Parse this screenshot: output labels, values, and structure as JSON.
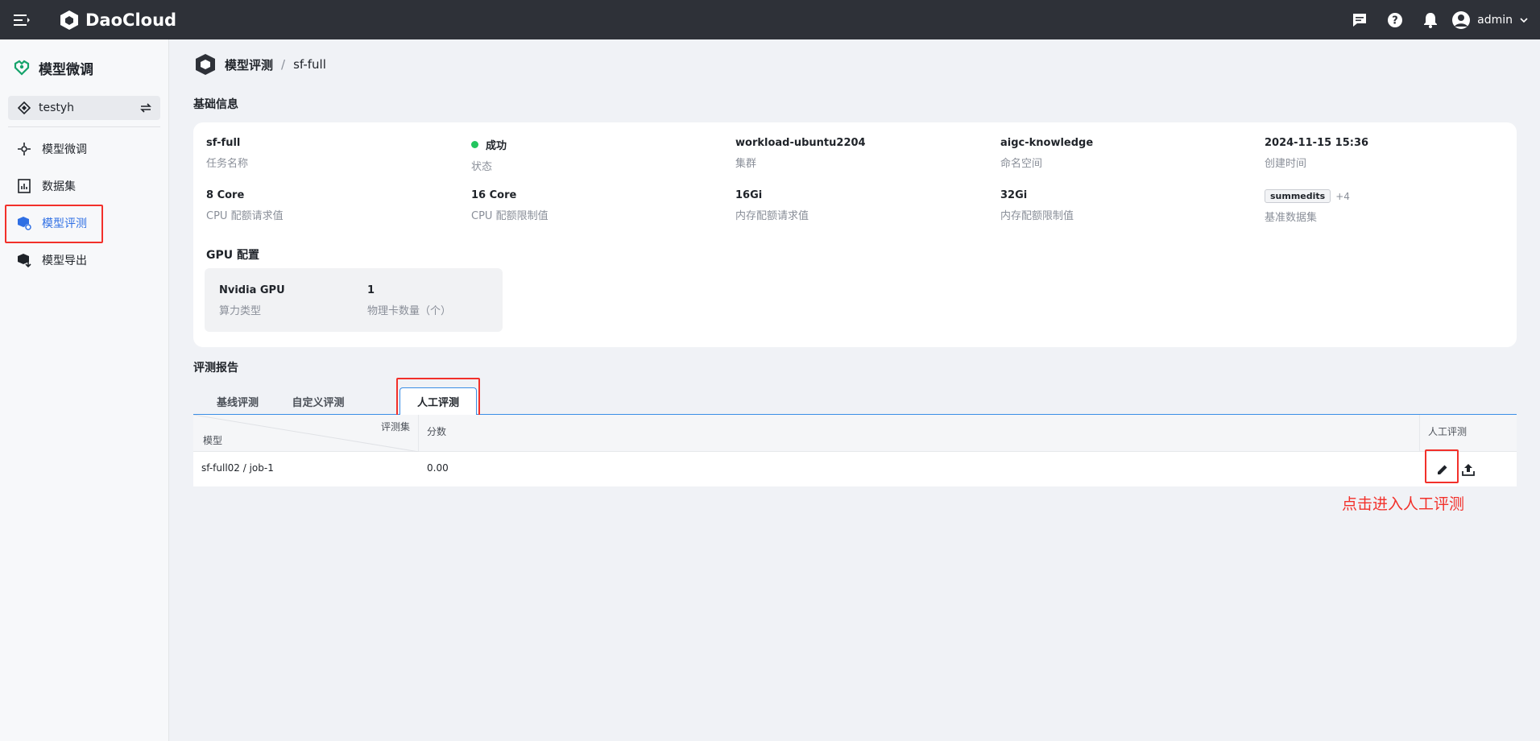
{
  "topbar": {
    "brand": "DaoCloud",
    "user": "admin"
  },
  "sidebar": {
    "title": "模型微调",
    "workspace": "testyh",
    "items": [
      {
        "label": "模型微调"
      },
      {
        "label": "数据集"
      },
      {
        "label": "模型评测"
      },
      {
        "label": "模型导出"
      }
    ]
  },
  "breadcrumb": {
    "parent": "模型评测",
    "sep": "/",
    "current": "sf-full"
  },
  "basic": {
    "section_title": "基础信息",
    "fields": [
      {
        "value": "sf-full",
        "label": "任务名称"
      },
      {
        "value": "成功",
        "label": "状态"
      },
      {
        "value": "workload-ubuntu2204",
        "label": "集群"
      },
      {
        "value": "aigc-knowledge",
        "label": "命名空间"
      },
      {
        "value": "2024-11-15 15:36",
        "label": "创建时间"
      },
      {
        "value": "8 Core",
        "label": "CPU 配额请求值"
      },
      {
        "value": "16 Core",
        "label": "CPU 配额限制值"
      },
      {
        "value": "16Gi",
        "label": "内存配额请求值"
      },
      {
        "value": "32Gi",
        "label": "内存配额限制值"
      },
      {
        "value": "summedits",
        "extra": "+4",
        "label": "基准数据集"
      }
    ],
    "status_color": "#22c55e",
    "gpu_title": "GPU 配置",
    "gpu": [
      {
        "value": "Nvidia GPU",
        "label": "算力类型"
      },
      {
        "value": "1",
        "label": "物理卡数量（个）"
      }
    ]
  },
  "report": {
    "section_title": "评测报告",
    "tabs": [
      "基线评测",
      "自定义评测",
      "人工评测"
    ],
    "active_tab": "人工评测",
    "table": {
      "corner_top": "评测集",
      "corner_bottom": "模型",
      "score_header": "分数",
      "action_header": "人工评测",
      "rows": [
        {
          "model": "sf-full02 / job-1",
          "score": "0.00"
        }
      ]
    }
  },
  "annotation": "点击进入人工评测",
  "colors": {
    "accent": "#2f6fe4",
    "highlight": "#f2302a",
    "topbar": "#2e3138"
  }
}
